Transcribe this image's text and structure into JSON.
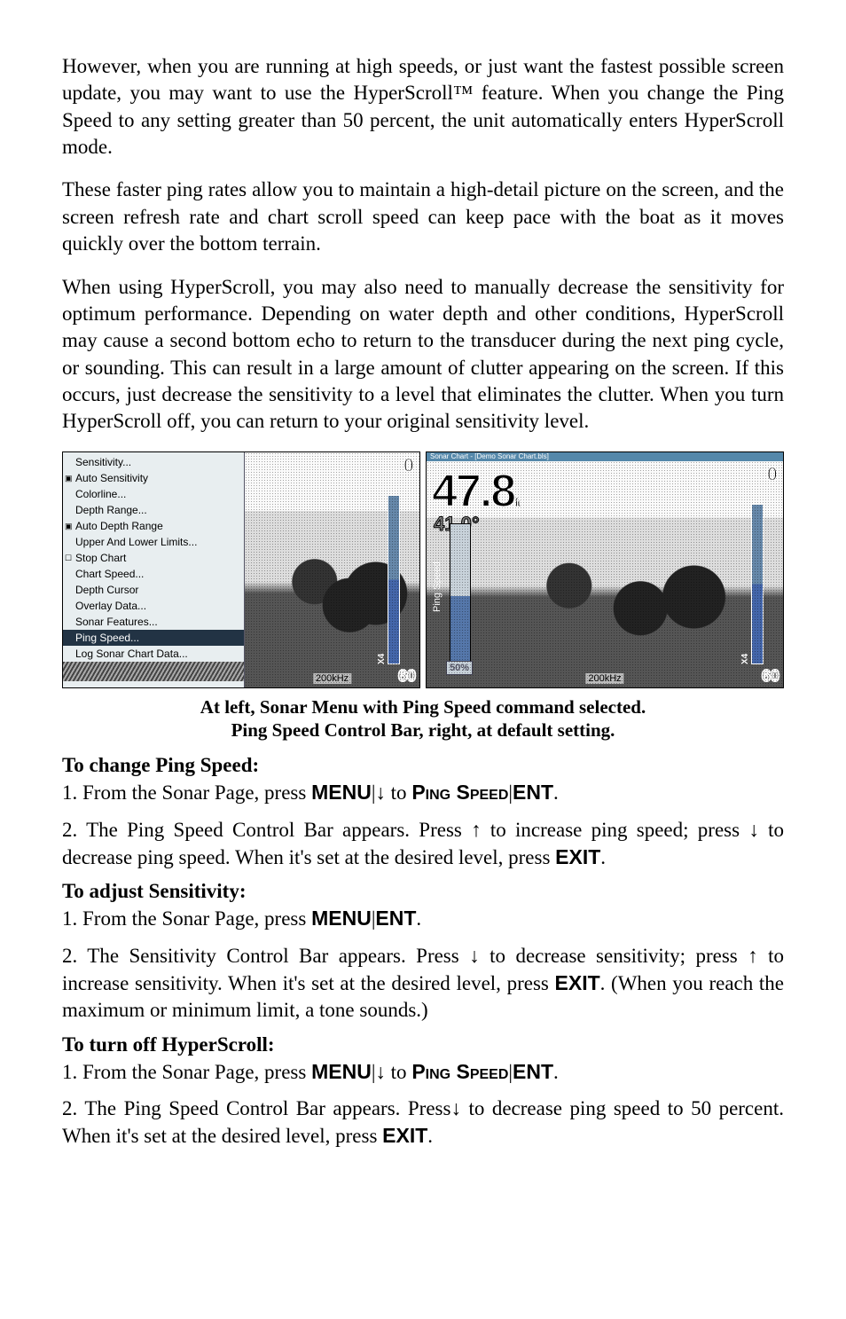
{
  "paragraphs": {
    "p1": "However, when you are running at high speeds, or just want the fastest possible screen update, you may want to use the HyperScroll™ feature. When you change the Ping Speed to any setting greater than 50 percent, the unit automatically enters HyperScroll mode.",
    "p2": "These faster ping rates allow you to maintain a high-detail picture on the screen, and the screen refresh rate and chart scroll speed can keep pace with the boat as it moves quickly over the bottom terrain.",
    "p3": "When using HyperScroll, you may also need to manually decrease the sensitivity for optimum performance. Depending on water depth and other conditions, HyperScroll may cause a second bottom echo to return to the transducer during the next ping cycle, or sounding. This can result in a large amount of clutter appearing on the screen. If this occurs, just decrease the sensitivity to a level that eliminates the clutter. When you turn HyperScroll off, you can return to your original sensitivity level."
  },
  "figure": {
    "left_menu": [
      {
        "label": "Sensitivity...",
        "checked": ""
      },
      {
        "label": "Auto Sensitivity",
        "checked": "auto"
      },
      {
        "label": "Colorline...",
        "checked": ""
      },
      {
        "label": "Depth Range...",
        "checked": ""
      },
      {
        "label": "Auto Depth Range",
        "checked": "auto"
      },
      {
        "label": "Upper And Lower Limits...",
        "checked": ""
      },
      {
        "label": "Stop Chart",
        "checked": "stop"
      },
      {
        "label": "Chart Speed...",
        "checked": ""
      },
      {
        "label": "Depth Cursor",
        "checked": ""
      },
      {
        "label": "Overlay Data...",
        "checked": ""
      },
      {
        "label": "Sonar Features...",
        "checked": ""
      },
      {
        "label": "Ping Speed...",
        "checked": "",
        "selected": true
      },
      {
        "label": "Log Sonar Chart Data...",
        "checked": ""
      }
    ],
    "left_scale_top": "0",
    "left_scale_bottom": "60",
    "left_khz": "200kHz",
    "left_scale_tag": "X4",
    "right_titlebar": "Sonar Chart - [Demo Sonar Chart.bls]",
    "right_depth_main": "47.8",
    "right_depth_unit": "ft",
    "right_depth_sub": "41.0°",
    "right_scale_top": "0",
    "right_scale_bottom": "60",
    "right_khz": "200kHz",
    "right_scale_tag": "X4",
    "right_ctrl_label": "Ping Speed",
    "right_ctrl_value": "50%",
    "caption_line1": "At left, Sonar Menu with Ping Speed command selected.",
    "caption_line2": "Ping Speed Control Bar, right, at default setting."
  },
  "sections": {
    "s1_title": "To change Ping Speed:",
    "s1_step1_a": "1. From the Sonar Page, press ",
    "s1_step1_menu": "MENU",
    "s1_step1_b": "|",
    "s1_step1_arrow1": "↓",
    "s1_step1_c": " to ",
    "s1_step1_ping": "Ping Speed",
    "s1_step1_d": "|",
    "s1_step1_ent": "ENT",
    "s1_step1_e": ".",
    "s1_step2_a": "2. The Ping Speed Control Bar appears. Press ",
    "s1_step2_up": "↑",
    "s1_step2_b": " to increase ping speed; press ",
    "s1_step2_down": "↓",
    "s1_step2_c": " to decrease ping speed. When it's set at the desired level, press ",
    "s1_step2_exit": "EXIT",
    "s1_step2_d": ".",
    "s2_title": "To adjust Sensitivity:",
    "s2_step1_a": "1. From the Sonar Page, press ",
    "s2_step1_menu": "MENU",
    "s2_step1_b": "|",
    "s2_step1_ent": "ENT",
    "s2_step1_c": ".",
    "s2_step2_a": "2. The Sensitivity Control Bar appears. Press ",
    "s2_step2_down": "↓",
    "s2_step2_b": " to decrease sensitivity; press ",
    "s2_step2_up": "↑",
    "s2_step2_c": " to increase sensitivity. When it's set at the desired level, press ",
    "s2_step2_exit": "EXIT",
    "s2_step2_d": ". (When you reach the maximum or minimum limit, a tone sounds.)",
    "s3_title": "To turn off HyperScroll:",
    "s3_step1_a": "1. From the Sonar Page, press ",
    "s3_step1_menu": "MENU",
    "s3_step1_b": "|",
    "s3_step1_arrow1": "↓",
    "s3_step1_c": " to ",
    "s3_step1_ping": "Ping Speed",
    "s3_step1_d": "|",
    "s3_step1_ent": "ENT",
    "s3_step1_e": ".",
    "s3_step2_a": "2. The Ping Speed Control Bar appears. Press",
    "s3_step2_down": "↓",
    "s3_step2_b": " to decrease ping speed to 50 percent. When it's set at the desired level, press ",
    "s3_step2_exit": "EXIT",
    "s3_step2_c": "."
  }
}
